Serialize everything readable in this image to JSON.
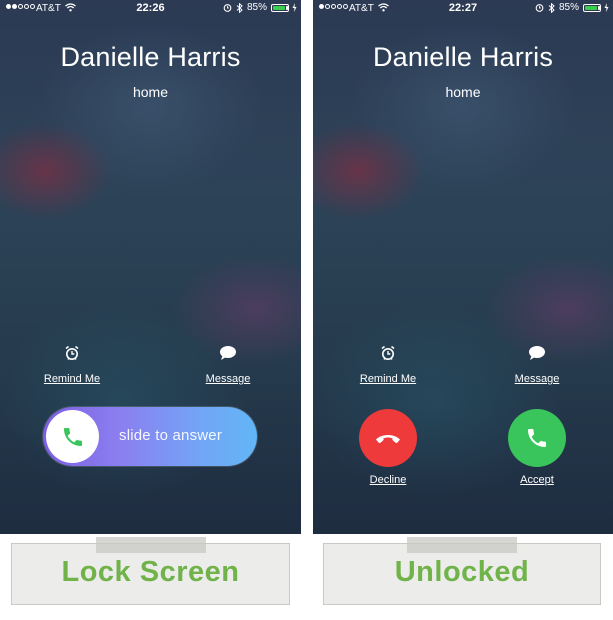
{
  "screens": [
    {
      "status": {
        "carrier": "AT&T",
        "time": "22:26",
        "battery": "85%",
        "battery_level": 0.85
      },
      "caller": {
        "name": "Danielle Harris",
        "label": "home"
      },
      "actions": {
        "remind_label": "Remind Me",
        "message_label": "Message"
      },
      "slider": {
        "text": "slide to answer"
      },
      "caption": "Lock Screen"
    },
    {
      "status": {
        "carrier": "AT&T",
        "time": "22:27",
        "battery": "85%",
        "battery_level": 0.85
      },
      "caller": {
        "name": "Danielle Harris",
        "label": "home"
      },
      "actions": {
        "remind_label": "Remind Me",
        "message_label": "Message"
      },
      "buttons": {
        "decline_label": "Decline",
        "accept_label": "Accept"
      },
      "caption": "Unlocked"
    }
  ],
  "colors": {
    "accent_green": "#39c45c",
    "decline_red": "#ee3a3a",
    "caption_green": "#6fb34a",
    "slider_purple": "#7d5fe0",
    "slider_blue": "#61b6f7",
    "battery_green": "#3ccf4e"
  },
  "icons": {
    "alarm": "alarm-clock-icon",
    "message": "speech-bubble-icon",
    "phone": "phone-handset-icon",
    "wifi": "wifi-icon",
    "bluetooth": "bluetooth-icon",
    "charging": "bolt-icon"
  }
}
